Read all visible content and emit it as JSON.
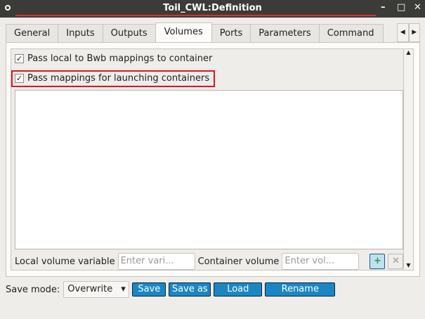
{
  "window": {
    "title": "Toil_CWL:Definition",
    "minimize": "–",
    "maximize": "□",
    "close": "✕"
  },
  "tabs": [
    "General",
    "Inputs",
    "Outputs",
    "Volumes",
    "Ports",
    "Parameters",
    "Command"
  ],
  "tab_arrows": {
    "left": "◀",
    "right": "▶"
  },
  "volumes": {
    "pass_local": {
      "label": "Pass local to Bwb mappings to container",
      "checked": true,
      "mark": "✓"
    },
    "pass_mappings": {
      "label": "Pass mappings for launching containers",
      "checked": true,
      "mark": "✓"
    },
    "local_label": "Local volume variable",
    "local_placeholder": "Enter vari...",
    "container_label": "Container volume",
    "container_placeholder": "Enter vol...",
    "add_icon": "+",
    "remove_icon": "✕",
    "scroll_up": "▲",
    "scroll_down": "▼"
  },
  "footer": {
    "save_mode_label": "Save mode:",
    "save_mode_value": "Overwrite",
    "dropdown_arrow": "▾",
    "save": "Save",
    "save_as": "Save as",
    "load": "Load",
    "rename": "Rename"
  }
}
